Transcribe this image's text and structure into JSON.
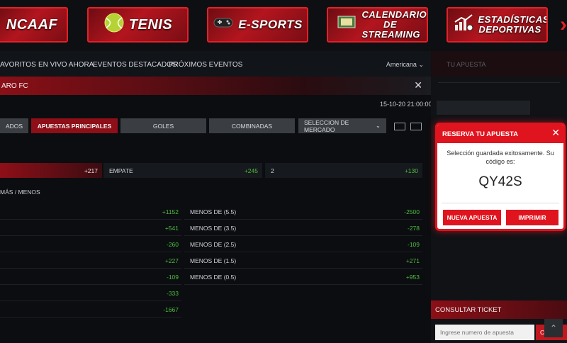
{
  "categories": [
    {
      "label": "NCAAF",
      "icon": "football-icon"
    },
    {
      "label": "TENIS",
      "icon": "tennis-ball-icon"
    },
    {
      "label": "E-SPORTS",
      "icon": "gamepad-icon"
    },
    {
      "label": "CALENDARIO DE STREAMING",
      "icon": "screen-icon"
    },
    {
      "label": "ESTADÍSTICAS DEPORTIVAS",
      "icon": "stats-chart-icon"
    }
  ],
  "nav": {
    "items": [
      "AVORITOS",
      "EN VIVO AHORA",
      "EVENTOS DESTACADOS",
      "PRÓXIMOS EVENTOS"
    ],
    "odds_format": "Americana"
  },
  "match": {
    "name": "ARO FC",
    "datetime": "15-10-20 21:00:00"
  },
  "tabs": [
    "ADOS",
    "APUESTAS PRINCIPALES",
    "GOLES",
    "COMBINADAS"
  ],
  "market_select": "SELECCION DE MERCADO",
  "main_odds": [
    {
      "label": "",
      "odd": "+217"
    },
    {
      "label": "EMPATE",
      "odd": "+245"
    },
    {
      "label": "2",
      "odd": "+130"
    }
  ],
  "over_under_title": "MÁS / MENOS",
  "over_rows": [
    "+1152",
    "+541",
    "-260",
    "+227",
    "-109",
    "-333",
    "-1667"
  ],
  "under_rows": [
    {
      "label": "MENOS DE (5.5)",
      "odd": "-2500"
    },
    {
      "label": "MENOS DE (3.5)",
      "odd": "-278"
    },
    {
      "label": "MENOS DE (2.5)",
      "odd": "-109"
    },
    {
      "label": "MENOS DE (1.5)",
      "odd": "+271"
    },
    {
      "label": "MENOS DE (0.5)",
      "odd": "+953"
    }
  ],
  "side": {
    "header": "TU APUESTA",
    "consult_title": "CONSULTAR TICKET",
    "ticket_placeholder": "Ingrese numero de apuesta",
    "ticket_button": "CHEC"
  },
  "modal": {
    "title": "RESERVA TU APUESTA",
    "message": "Selección guardada exitosamente. Su código es:",
    "code": "QY42S",
    "new_bet": "NUEVA APUESTA",
    "print": "IMPRIMIR"
  },
  "colors": {
    "accent": "#e0141e",
    "positive": "#4dbf3f"
  }
}
